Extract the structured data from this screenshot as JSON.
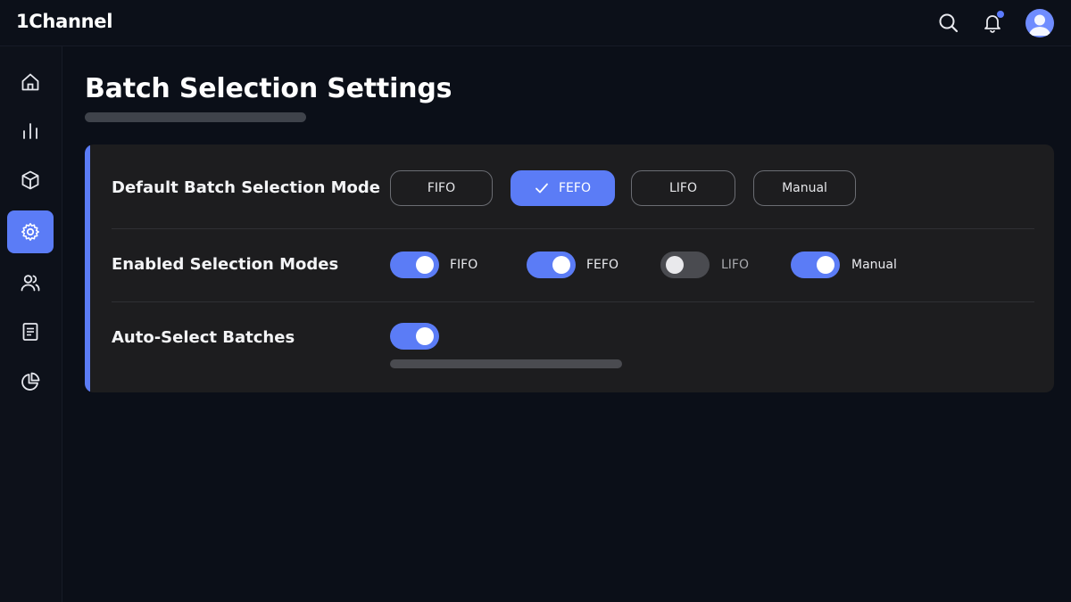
{
  "app": {
    "title": "1Channel"
  },
  "header": {
    "icons": [
      "search-icon",
      "bell-icon",
      "user-avatar-icon"
    ],
    "notification_dot": true
  },
  "sidebar": {
    "items": [
      {
        "name": "home",
        "icon": "home-icon",
        "active": false
      },
      {
        "name": "analytics",
        "icon": "bar-chart-icon",
        "active": false
      },
      {
        "name": "products",
        "icon": "box-icon",
        "active": false
      },
      {
        "name": "settings",
        "icon": "gear-icon",
        "active": true
      },
      {
        "name": "users",
        "icon": "users-icon",
        "active": false
      },
      {
        "name": "documents",
        "icon": "document-icon",
        "active": false
      },
      {
        "name": "reports",
        "icon": "pie-chart-icon",
        "active": false
      }
    ]
  },
  "page": {
    "title": "Batch Selection Settings"
  },
  "settings": {
    "default_mode": {
      "label": "Default Batch Selection Mode",
      "options": [
        "FIFO",
        "FEFO",
        "LIFO",
        "Manual"
      ],
      "selected": "FEFO"
    },
    "enabled_modes": {
      "label": "Enabled Selection Modes",
      "toggles": [
        {
          "label": "FIFO",
          "on": true
        },
        {
          "label": "FEFO",
          "on": true
        },
        {
          "label": "LIFO",
          "on": false
        },
        {
          "label": "Manual",
          "on": true
        }
      ]
    },
    "auto_select": {
      "label": "Auto-Select Batches",
      "on": true
    }
  },
  "colors": {
    "accent": "#5b7cf6",
    "background": "#0b0f18",
    "card": "#1d1d1f"
  }
}
